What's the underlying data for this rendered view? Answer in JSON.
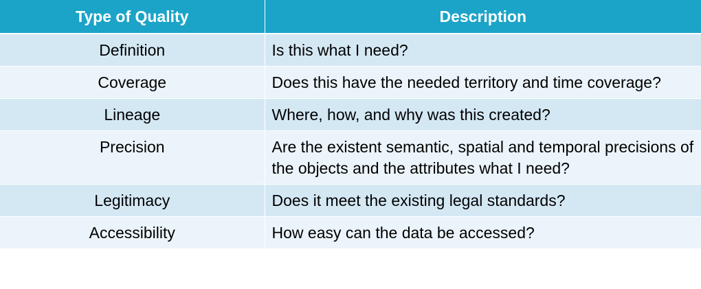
{
  "table": {
    "headers": [
      "Type of Quality",
      "Description"
    ],
    "rows": [
      {
        "type": "Definition",
        "description": "Is this what I need?"
      },
      {
        "type": "Coverage",
        "description": "Does this have the needed territory and time coverage?"
      },
      {
        "type": "Lineage",
        "description": "Where, how, and why was this created?"
      },
      {
        "type": "Precision",
        "description": "Are the existent semantic, spatial and temporal precisions of the objects and the attributes what I need?"
      },
      {
        "type": "Legitimacy",
        "description": "Does it meet the existing legal standards?"
      },
      {
        "type": "Accessibility",
        "description": "How easy can the data be accessed?"
      }
    ]
  },
  "colors": {
    "header_bg": "#1ba4c8",
    "header_text": "#ffffff",
    "row_odd_bg": "#d4e8f4",
    "row_even_bg": "#ebf4fa"
  }
}
